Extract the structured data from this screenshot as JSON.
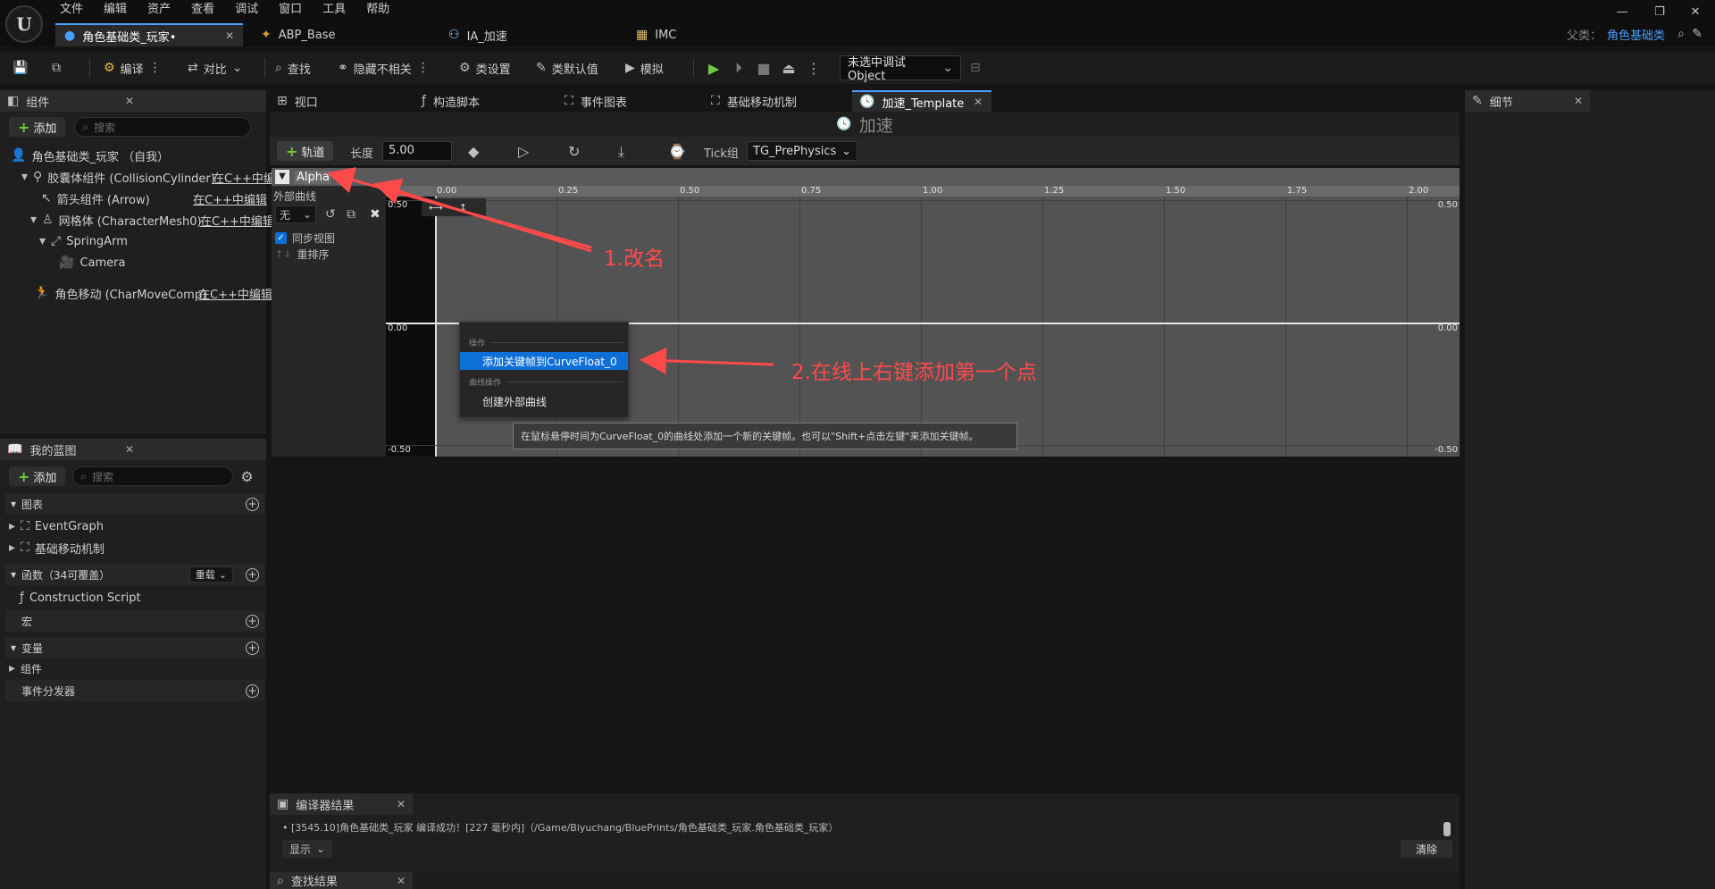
{
  "menu": [
    "文件",
    "编辑",
    "资产",
    "查看",
    "调试",
    "窗口",
    "工具",
    "帮助"
  ],
  "logo_glyph": "U",
  "doc_tabs": [
    {
      "label": "角色基础类_玩家•",
      "icon": "character-icon"
    },
    {
      "label": "ABP_Base",
      "icon": "anim-blueprint-icon"
    },
    {
      "label": "IA_加速",
      "icon": "input-action-icon"
    },
    {
      "label": "IMC",
      "icon": "input-mapping-icon"
    }
  ],
  "parent_class": {
    "label": "父类：",
    "value": "角色基础类"
  },
  "toolbar": {
    "compile": "编译",
    "diff": "对比",
    "find": "查找",
    "hide_unrelated": "隐藏不相关",
    "class_settings": "类设置",
    "class_defaults": "类默认值",
    "simulate": "模拟",
    "debug_object": "未选中调试Object"
  },
  "components_panel": {
    "title": "组件",
    "add_label": "添加",
    "search_placeholder": "搜索",
    "items": [
      {
        "label": "角色基础类_玩家 （自我）",
        "link": ""
      },
      {
        "label": "胶囊体组件 (CollisionCylinder)",
        "link": "在C++中编"
      },
      {
        "label": "箭头组件 (Arrow)",
        "link": "在C++中编辑"
      },
      {
        "label": "网格体 (CharacterMesh0)",
        "link": "在C++中编辑"
      },
      {
        "label": "SpringArm",
        "link": ""
      },
      {
        "label": "Camera",
        "link": ""
      },
      {
        "label": "角色移动 (CharMoveComp)",
        "link": "在C++中编辑"
      }
    ]
  },
  "blueprint_panel": {
    "title": "我的蓝图",
    "add_label": "添加",
    "search_placeholder": "搜索",
    "graphs_label": "图表",
    "graphs": [
      "EventGraph",
      "基础移动机制"
    ],
    "functions_label": "函数（34可覆盖）",
    "override_label": "重载",
    "functions": [
      "Construction Script"
    ],
    "macros_label": "宏",
    "variables_label": "变量",
    "variables_sub": "组件",
    "dispatchers_label": "事件分发器"
  },
  "editor_tabs": [
    "视口",
    "构造脚本",
    "事件图表",
    "基础移动机制",
    "加速_Template"
  ],
  "timeline": {
    "title": "加速",
    "track_label": "轨道",
    "length_label": "长度",
    "length_value": "5.00",
    "tick_group_label": "Tick组",
    "tick_group_value": "TG_PrePhysics",
    "track_name": "Alpha",
    "external_curve_label": "外部曲线",
    "external_curve_value": "无",
    "sync_view_label": "同步视图",
    "reorder_label": "重排序",
    "x_ticks": [
      "0.00",
      "0.25",
      "0.50",
      "0.75",
      "1.00",
      "1.25",
      "1.50",
      "1.75",
      "2.00"
    ],
    "y_ticks": [
      "0.50",
      "0.00",
      "-0.50"
    ]
  },
  "context_menu": {
    "section1": "操作",
    "item1": "添加关键帧到CurveFloat_0",
    "section2": "曲线操作",
    "item2": "创建外部曲线"
  },
  "tooltip": "在鼠标悬停时间为CurveFloat_0的曲线处添加一个新的关键帧。也可以\"Shift+点击左键\"来添加关键帧。",
  "annotations": [
    "1.改名",
    "2.在线上右键添加第一个点"
  ],
  "compiler": {
    "title": "编译器结果",
    "message": "[3545.10]角色基础类_玩家 编译成功！[227 毫秒内]（/Game/Biyuchang/BluePrints/角色基础类_玩家.角色基础类_玩家）",
    "show_label": "显示",
    "clear_label": "清除"
  },
  "find_results": {
    "title": "查找结果"
  },
  "details": {
    "title": "细节"
  },
  "colors": {
    "accent": "#0f6fd8",
    "annotation": "#ff4a4a",
    "play": "#6ecb3b"
  }
}
